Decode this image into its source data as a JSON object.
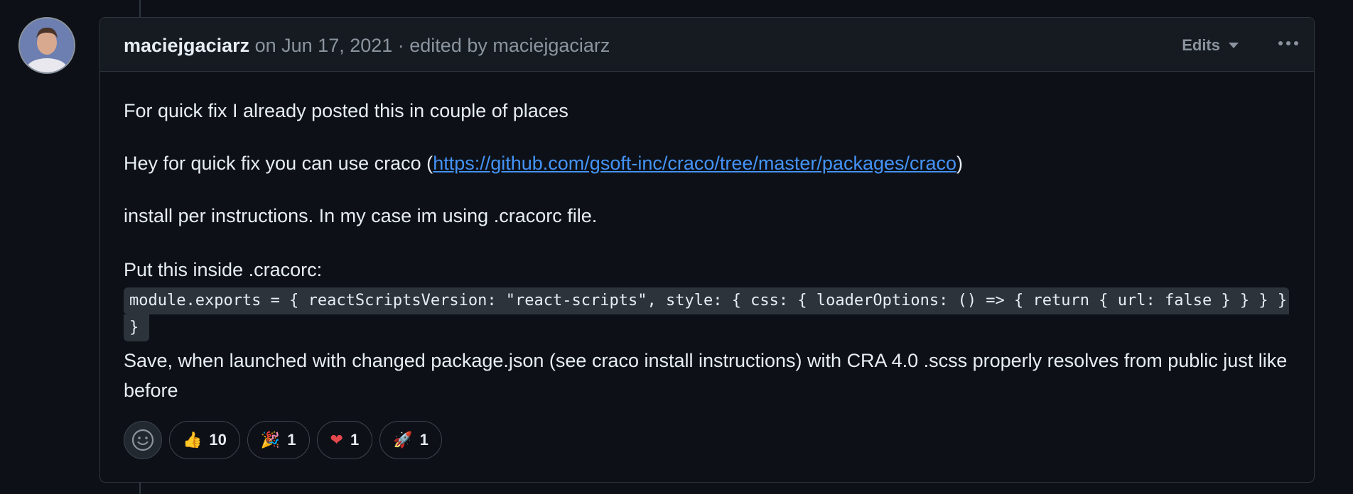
{
  "header": {
    "author": "maciejgaciarz",
    "meta": " on Jun 17, 2021 · edited by maciejgaciarz",
    "edits_label": "Edits"
  },
  "body": {
    "p1": "For quick fix I already posted this in couple of places",
    "p2_prefix": "Hey for quick fix you can use craco (",
    "p2_link": "https://github.com/gsoft-inc/craco/tree/master/packages/craco",
    "p2_suffix": ")",
    "p3": "install per instructions. In my case im using .cracorc file.",
    "p4": "Put this inside .cracorc:",
    "code_line1": "module.exports = { reactScriptsVersion: \"react-scripts\", style: { css: { loaderOptions: () => { return { url: false } } } }",
    "code_line2": "}",
    "p5": "Save, when launched with changed package.json (see craco install instructions) with CRA 4.0 .scss properly resolves from public just like before"
  },
  "reactions": [
    {
      "icon": "thumbs-up-icon",
      "emoji": "👍",
      "count": "10"
    },
    {
      "icon": "party-popper-icon",
      "emoji": "🎉",
      "count": "1"
    },
    {
      "icon": "heart-icon",
      "emoji": "❤",
      "count": "1"
    },
    {
      "icon": "rocket-icon",
      "emoji": "🚀",
      "count": "1"
    }
  ],
  "colors": {
    "background": "#0d1117",
    "header_bg": "#161b22",
    "border": "#30363d",
    "link": "#4493f8",
    "muted": "#8b949e",
    "code_bg": "#2d333b"
  }
}
